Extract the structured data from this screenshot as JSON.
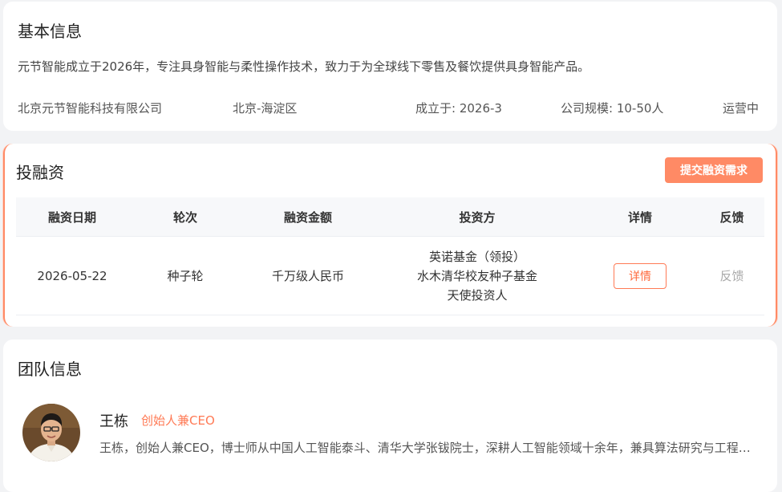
{
  "basic_info": {
    "title": "基本信息",
    "description": "元节智能成立于2026年，专注具身智能与柔性操作技术，致力于为全球线下零售及餐饮提供具身智能产品。",
    "company_name": "北京元节智能科技有限公司",
    "location": "北京-海淀区",
    "founded": "成立于: 2026-3",
    "scale": "公司规模: 10-50人",
    "status": "运营中"
  },
  "funding": {
    "title": "投融资",
    "submit_button": "提交融资需求",
    "columns": [
      "融资日期",
      "轮次",
      "融资金额",
      "投资方",
      "详情",
      "反馈"
    ],
    "rows": [
      {
        "date": "2026-05-22",
        "round": "种子轮",
        "amount": "千万级人民币",
        "investors": [
          "英诺基金（领投）",
          "水木清华校友种子基金",
          "天使投资人"
        ],
        "detail_label": "详情",
        "feedback_label": "反馈"
      }
    ]
  },
  "team": {
    "title": "团队信息",
    "members": [
      {
        "name": "王栋",
        "role": "创始人兼CEO",
        "bio": "王栋，创始人兼CEO，博士师从中国人工智能泰斗、清华大学张钹院士，深耕人工智能领域十余年，兼具算法研究与工程落地经验",
        "avatar": "avatar-photo"
      }
    ]
  },
  "colors": {
    "accent": "#ff8a65",
    "accent_text": "#ff6a3d",
    "background": "#f2f3f5"
  }
}
